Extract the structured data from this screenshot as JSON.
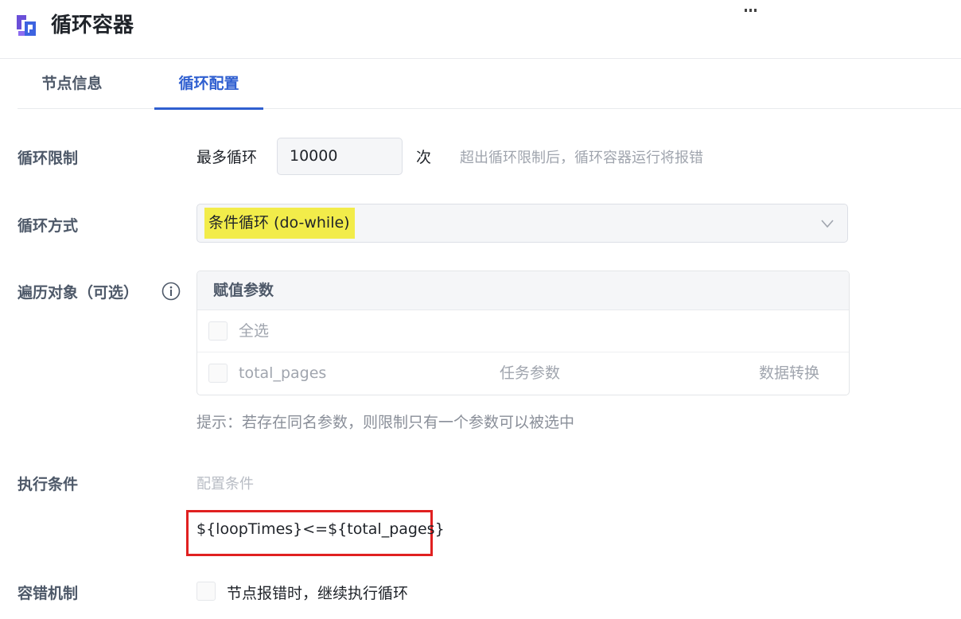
{
  "app": {
    "title": "循环容器",
    "icon": "loop-container-icon"
  },
  "tabs": [
    {
      "label": "节点信息",
      "active": false
    },
    {
      "label": "循环配置",
      "active": true
    }
  ],
  "loop_limit": {
    "label": "循环限制",
    "prefix": "最多循环",
    "value": "10000",
    "suffix": "次",
    "hint": "超出循环限制后，循环容器运行将报错"
  },
  "loop_mode": {
    "label": "循环方式",
    "selected": "条件循环 (do-while)"
  },
  "traverse": {
    "label": "遍历对象（可选）",
    "table_header": "赋值参数",
    "select_all": "全选",
    "rows": [
      {
        "name": "total_pages",
        "type": "任务参数",
        "action": "数据转换"
      }
    ],
    "tip": "提示：若存在同名参数，则限制只有一个参数可以被选中"
  },
  "condition": {
    "label": "执行条件",
    "placeholder": "配置条件",
    "expression": "${loopTimes}<=${total_pages}"
  },
  "fault_tolerance": {
    "label": "容错机制",
    "option": "节点报错时，继续执行循环"
  },
  "colors": {
    "accent": "#2f5fd0",
    "highlight": "#f2ec4a",
    "annotation_border": "#e02020"
  }
}
